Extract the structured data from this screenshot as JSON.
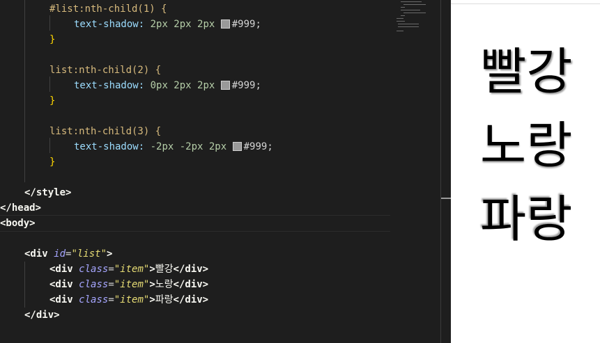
{
  "editor": {
    "css": [
      {
        "selector": "#list:nth-child(1) {",
        "prop": "text-shadow:",
        "nums": "2px 2px 2px",
        "color": "#999;"
      },
      {
        "selector": "list:nth-child(2) {",
        "prop": "text-shadow:",
        "nums": "0px 2px 2px",
        "color": "#999;"
      },
      {
        "selector": "list:nth-child(3) {",
        "prop": "text-shadow:",
        "nums": "-2px -2px 2px",
        "color": "#999;"
      }
    ],
    "close_brace": "}",
    "style_close": "</style>",
    "head_close": "</head>",
    "body_open": "<body>",
    "div_open": {
      "open": "<div ",
      "attr": "id",
      "eq": "=",
      "val": "\"list\"",
      "gt": ">"
    },
    "items": [
      {
        "open": "<div ",
        "attr": "class",
        "eq": "=",
        "val": "\"item\"",
        "gt": ">",
        "text": "빨강",
        "close": "</div>"
      },
      {
        "open": "<div ",
        "attr": "class",
        "eq": "=",
        "val": "\"item\"",
        "gt": ">",
        "text": "노랑",
        "close": "</div>"
      },
      {
        "open": "<div ",
        "attr": "class",
        "eq": "=",
        "val": "\"item\"",
        "gt": ">",
        "text": "파랑",
        "close": "</div>"
      }
    ],
    "div_close": "</div>",
    "swatch_color": "#999999"
  },
  "preview": {
    "items": [
      "빨강",
      "노랑",
      "파랑"
    ],
    "shadow_color": "#999999"
  },
  "colors": {
    "editor_bg": "#1e1e1e",
    "selector": "#d7ba7d",
    "property": "#9cdcfe",
    "number": "#b5cea8",
    "brace": "#ffd700",
    "attribute": "#a6a6ff",
    "string": "#e6db74",
    "preview_bg": "#ffffff"
  }
}
